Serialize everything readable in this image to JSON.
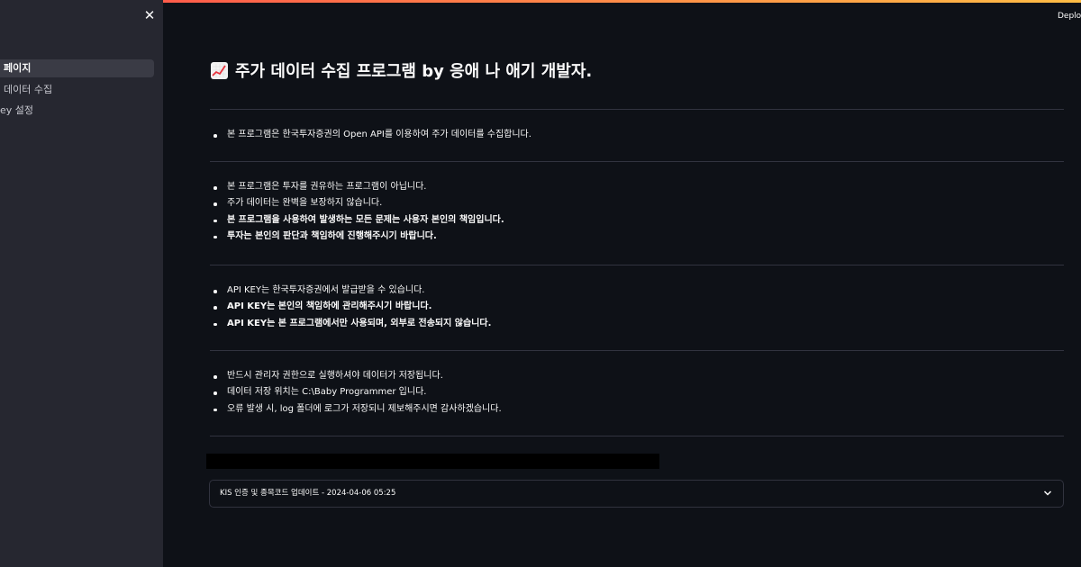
{
  "sidebar": {
    "close_glyph": "✕",
    "items": [
      {
        "label": "페이지",
        "active": true
      },
      {
        "label": "데이터 수집",
        "active": false
      },
      {
        "label": "ey 설정",
        "active": false
      }
    ]
  },
  "header": {
    "deploy_label": "Deplo"
  },
  "main": {
    "title": "주가 데이터 수집 프로그램 by 응애 나 애기 개발자.",
    "title_icon": "chart-increasing-icon",
    "sections": [
      {
        "items": [
          {
            "text": "본 프로그램은 한국투자증권의 Open API를 이용하여 주가 데이터를 수집합니다.",
            "bold": false
          }
        ]
      },
      {
        "items": [
          {
            "text": "본 프로그램은 투자를 권유하는 프로그램이 아닙니다.",
            "bold": false
          },
          {
            "text": "주가 데이터는 완벽을 보장하지 않습니다.",
            "bold": false
          },
          {
            "text": "본 프로그램을 사용하여 발생하는 모든 문제는 사용자 본인의 책임입니다.",
            "bold": true
          },
          {
            "text": "투자는 본인의 판단과 책임하에 진행해주시기 바랍니다.",
            "bold": true
          }
        ]
      },
      {
        "items": [
          {
            "text": "API KEY는 한국투자증권에서 발급받을 수 있습니다.",
            "bold": false
          },
          {
            "text": "API KEY는 본인의 책임하에 관리해주시기 바랍니다.",
            "bold": true
          },
          {
            "text": "API KEY는 본 프로그램에서만 사용되며, 외부로 전송되지 않습니다.",
            "bold": true
          }
        ]
      },
      {
        "items": [
          {
            "text": "반드시 관리자 권한으로 실행하셔야 데이터가 저장됩니다.",
            "bold": false
          },
          {
            "text": "데이터 저장 위치는 C:\\Baby Programmer 입니다.",
            "bold": false
          },
          {
            "text": "오류 발생 시, log 폴더에 로그가 저장되니 제보해주시면 감사하겠습니다.",
            "bold": false
          }
        ]
      }
    ],
    "expander": {
      "label": "KIS 인증 및 종목코드 업데이트 - 2024-04-06 05:25",
      "icon": "chevron-down-icon"
    }
  },
  "colors": {
    "background": "#0e1117",
    "sidebar": "#262730",
    "divider": "#31333f",
    "text": "#fafafa"
  }
}
